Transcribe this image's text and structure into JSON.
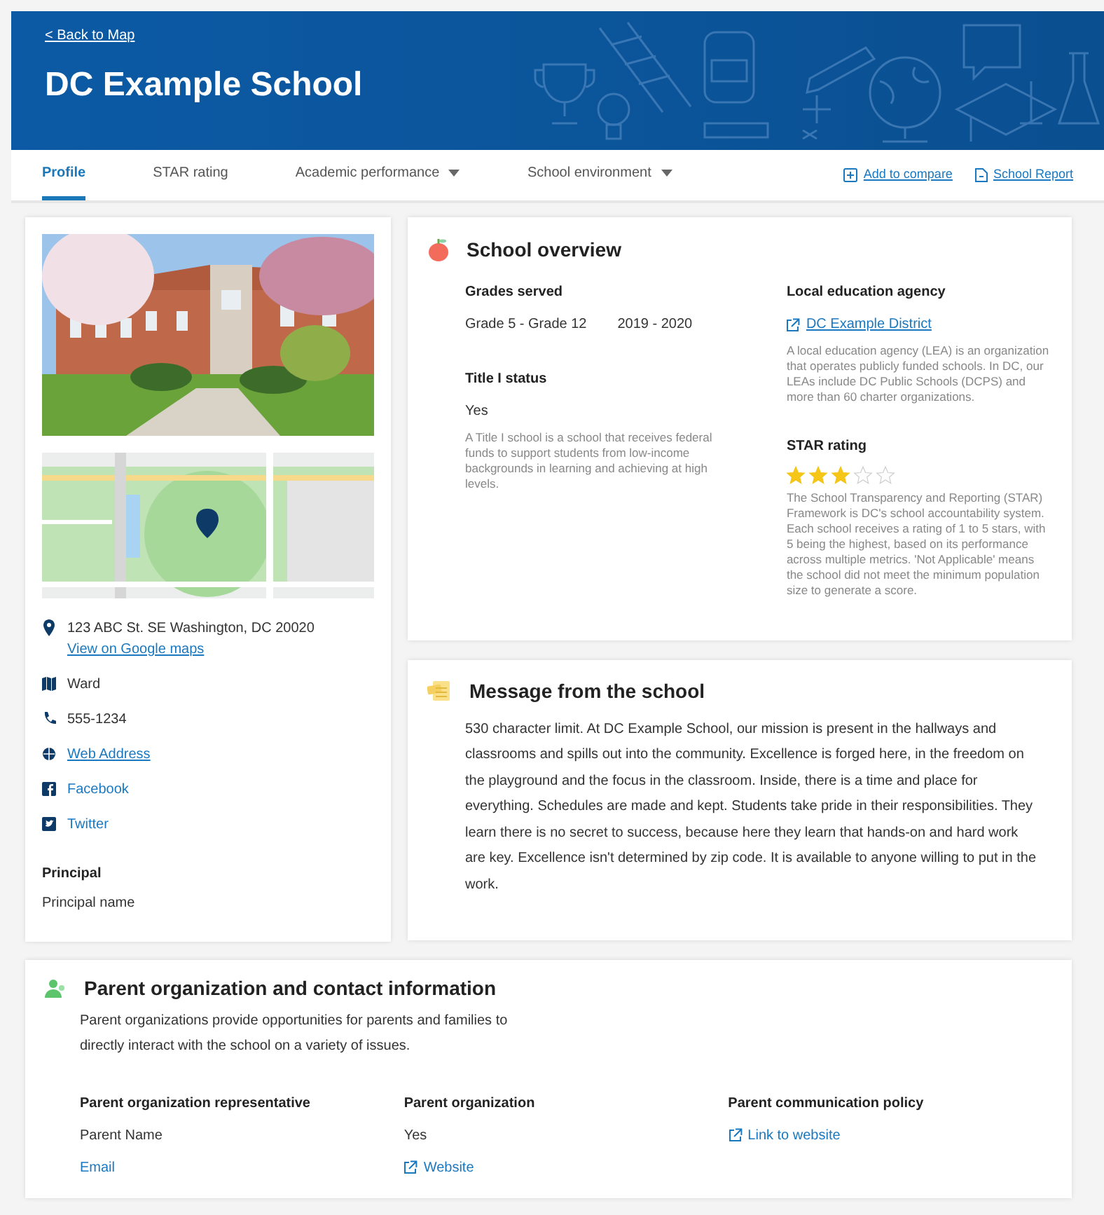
{
  "header": {
    "back_link": "< Back to Map",
    "title": "DC Example School"
  },
  "tabs": [
    {
      "label": "Profile",
      "selected": true,
      "dropdown": false
    },
    {
      "label": "STAR rating",
      "selected": false,
      "dropdown": false
    },
    {
      "label": "Academic performance",
      "selected": false,
      "dropdown": true
    },
    {
      "label": "School environment",
      "selected": false,
      "dropdown": true
    }
  ],
  "actions": [
    {
      "kind": "compare",
      "label": "Add to compare"
    },
    {
      "kind": "report",
      "label": "School Report"
    }
  ],
  "sidebar": {
    "contacts": [
      {
        "kind": "address",
        "text": "123 ABC St. SE Washington, DC 20020",
        "sublink": "View on Google maps",
        "link": false
      },
      {
        "kind": "ward",
        "text": "Ward",
        "link": false
      },
      {
        "kind": "phone",
        "text": "555-1234",
        "link": false
      },
      {
        "kind": "web",
        "text": "Web Address",
        "link": true
      },
      {
        "kind": "facebook",
        "text": "Facebook",
        "link": true
      },
      {
        "kind": "twitter",
        "text": "Twitter",
        "link": true
      }
    ],
    "principal": {
      "label": "Principal",
      "value": "Principal name"
    }
  },
  "overview": {
    "title": "School overview",
    "grades": {
      "label": "Grades served",
      "value": "Grade 5 - Grade 12",
      "year": "2019 - 2020"
    },
    "title1": {
      "label": "Title I status",
      "value": "Yes",
      "description": "A Title I school is a school that receives federal funds to support students from low-income backgrounds in learning and achieving at high levels."
    },
    "lea": {
      "label": "Local education agency",
      "link": "DC Example District",
      "description": "A local education agency (LEA) is an organization that operates publicly funded schools. In DC, our LEAs include DC Public Schools (DCPS) and more than 60 charter organizations."
    },
    "star": {
      "label": "STAR rating",
      "stars": 3,
      "description": "The School Transparency and Reporting (STAR) Framework is DC's school accountability system. Each school receives a rating of 1 to 5 stars, with 5 being the highest, based on its performance across multiple metrics. 'Not Applicable' means the school did not meet the minimum population size to generate a score."
    }
  },
  "message": {
    "title": "Message from the school",
    "text": "530 character limit. At DC Example School, our mission is present in the hallways and classrooms and spills out into the community. Excellence is forged here, in the freedom on the playground and the focus in the classroom. Inside, there is a time and place for everything. Schedules are made and kept. Students take pride in their responsibilities. They learn there is no secret to success, because here they learn that hands-on and hard work are key. Excellence isn't determined by zip code. It is available to anyone willing to put in the work."
  },
  "parent": {
    "title": "Parent organization and contact information",
    "description": "Parent organizations provide opportunities for parents and families to directly interact with the school on a variety of issues.",
    "columns": [
      {
        "label": "Parent organization representative",
        "value": "Parent Name",
        "link": "Email",
        "external": false
      },
      {
        "label": "Parent organization",
        "value": "Yes",
        "link": "Website",
        "external": true
      },
      {
        "label": "Parent communication policy",
        "link": "Link to website",
        "external": true
      }
    ]
  }
}
